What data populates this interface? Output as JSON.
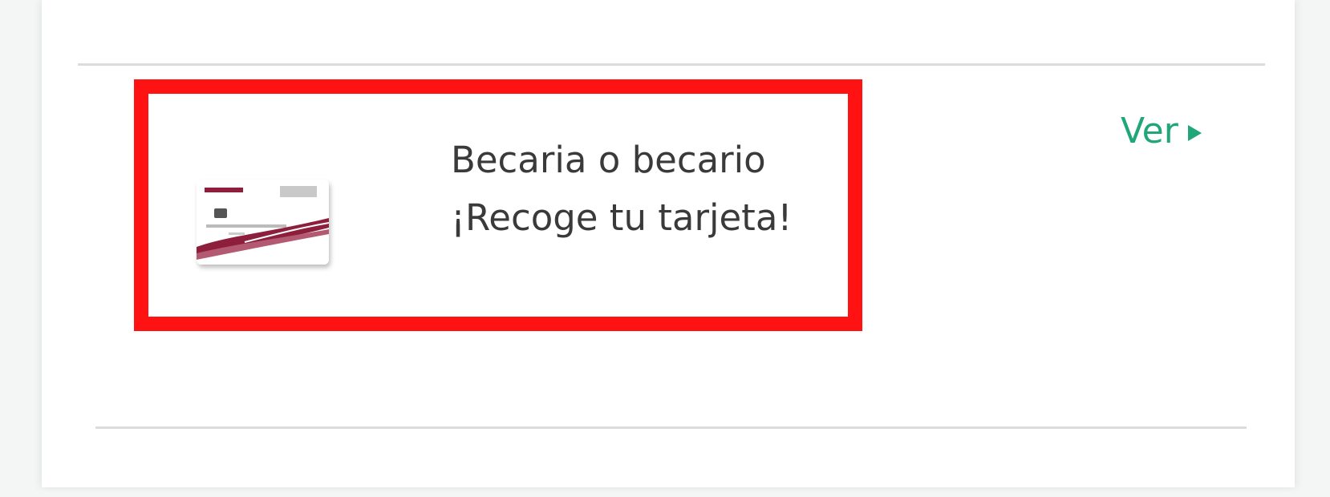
{
  "item": {
    "title_line1": "Becaria o becario",
    "title_line2": "¡Recoge tu tarjeta!",
    "link_label": "Ver",
    "image_icon": "bank-card-icon"
  },
  "colors": {
    "link": "#1fa679",
    "highlight_border": "#ff1212",
    "card_wave": "#8e1f3c",
    "text": "#3a3a3a"
  }
}
